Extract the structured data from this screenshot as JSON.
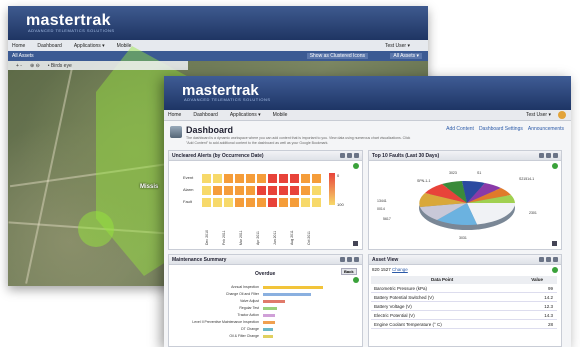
{
  "back_window": {
    "logo": "mastertrak",
    "tagline": "ADVANCED TELEMATICS SOLUTIONS",
    "nav": [
      "Home",
      "Dashboard",
      "Applications ▾",
      "Mobile"
    ],
    "user": "Test User ▾",
    "toolbar_left": "All Assets",
    "toolbar_mid": "Show as Clustered Icons",
    "toolbar_right": "All Assets ▾",
    "map_subbar": [
      "+  -",
      "⊕  ⊖",
      "• Birds eye"
    ],
    "map_labels": [
      "Missis"
    ]
  },
  "front_window": {
    "logo": "mastertrak",
    "tagline": "ADVANCED TELEMATICS SOLUTIONS",
    "nav": [
      "Home",
      "Dashboard",
      "Applications ▾",
      "Mobile"
    ],
    "user": "Test User ▾",
    "dashboard": {
      "title": "Dashboard",
      "description": "The dashboard is a dynamic workspace where you can add content that is important to you. View data using numerous chart visualizations. Click \"Add Content\" to add additional content to the dashboard as well as your Google Bookmark.",
      "actions": [
        "Add Content",
        "Dashboard Settings",
        "Announcements"
      ]
    },
    "alerts_panel": {
      "title": "Uncleared Alerts (by Occurrence Date)",
      "rows": [
        "Event",
        "Alarm",
        "Fault"
      ],
      "columns": [
        "Dec 2010",
        "Feb 2011",
        "Mar 2011",
        "Apr 2011",
        "Jun 2011",
        "Aug 2011",
        "Oct 2011"
      ],
      "legend_max": "0",
      "legend_min": "100"
    },
    "faults_panel": {
      "title": "Top 10 Faults (Last 30 Days)",
      "slice_labels": [
        "SPN-1-1",
        "3023",
        "S1",
        "S21514-1",
        "13441",
        "0014",
        "5617",
        "2301",
        "3031",
        "7080"
      ]
    },
    "maintenance_panel": {
      "title": "Maintenance Summary",
      "chart_title": "Overdue",
      "back_label": "Back",
      "items": [
        "Annual Inspection",
        "Change Oil and Filter",
        "Valve Adjust",
        "Regular Test",
        "Tractor Action",
        "Level II Preventive Maintenance Inspection",
        "DT Change",
        "Oil & Filter Change"
      ]
    },
    "asset_panel": {
      "title": "Asset View",
      "asset": "820 1527",
      "change_link": "Change",
      "headers": [
        "Data Point",
        "Value"
      ],
      "rows": [
        {
          "name": "Barometric Pressure (kPa)",
          "value": "99"
        },
        {
          "name": "Battery Potential Switched (V)",
          "value": "14.2"
        },
        {
          "name": "Battery Voltage (V)",
          "value": "12.3"
        },
        {
          "name": "Electric Potential (V)",
          "value": "14.3"
        },
        {
          "name": "Engine Coolant Temperature (° C)",
          "value": "28"
        }
      ]
    }
  },
  "colors": {
    "header_blue": "#1e3565",
    "heat_high": "#e8433a",
    "heat_mid": "#f59d3a",
    "heat_low": "#f7d96a",
    "geofence": "#96e63c"
  }
}
